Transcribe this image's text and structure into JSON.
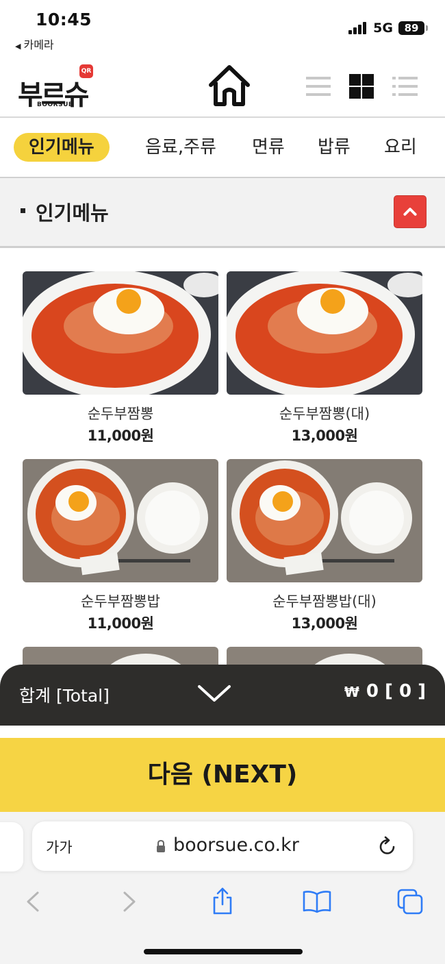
{
  "status_bar": {
    "time": "10:45",
    "back_app": "카메라",
    "network": "5G",
    "battery": "89"
  },
  "header": {
    "logo_text": "부르슈",
    "logo_sub": "BOORSUE",
    "logo_badge": "QR",
    "home_icon": "home-icon",
    "view_modes": [
      "list-view-icon",
      "grid-view-icon",
      "detail-list-icon"
    ],
    "active_view": "grid-view-icon"
  },
  "categories": {
    "items": [
      "인기메뉴",
      "음료,주류",
      "면류",
      "밥류",
      "요리"
    ],
    "active": "인기메뉴",
    "active_color": "#f5d23d"
  },
  "section": {
    "title": "인기메뉴",
    "collapse_icon": "chevron-up-icon",
    "button_color": "#e8403a"
  },
  "menu": {
    "items": [
      {
        "name": "순두부짬뽕",
        "price": "11,000원",
        "image": "soup-with-egg"
      },
      {
        "name": "순두부짬뽕(대)",
        "price": "13,000원",
        "image": "soup-with-egg"
      },
      {
        "name": "순두부짬뽕밥",
        "price": "11,000원",
        "image": "soup-with-egg-and-rice"
      },
      {
        "name": "순두부짬뽕밥(대)",
        "price": "13,000원",
        "image": "soup-with-egg-and-rice"
      },
      {
        "name": "",
        "price": "",
        "image": "partial"
      },
      {
        "name": "",
        "price": "",
        "image": "partial"
      }
    ]
  },
  "total": {
    "label": "합계 [Total]",
    "currency": "₩",
    "amount": "0",
    "count": "[ 0 ]",
    "toggle_icon": "chevron-down-icon"
  },
  "next_button": {
    "label": "다음 (NEXT)",
    "color": "#f6d444"
  },
  "browser": {
    "text_size_label": "가가",
    "url": "boorsue.co.kr",
    "icons": [
      "back-icon",
      "forward-icon",
      "share-icon",
      "bookmarks-icon",
      "tabs-icon"
    ]
  }
}
